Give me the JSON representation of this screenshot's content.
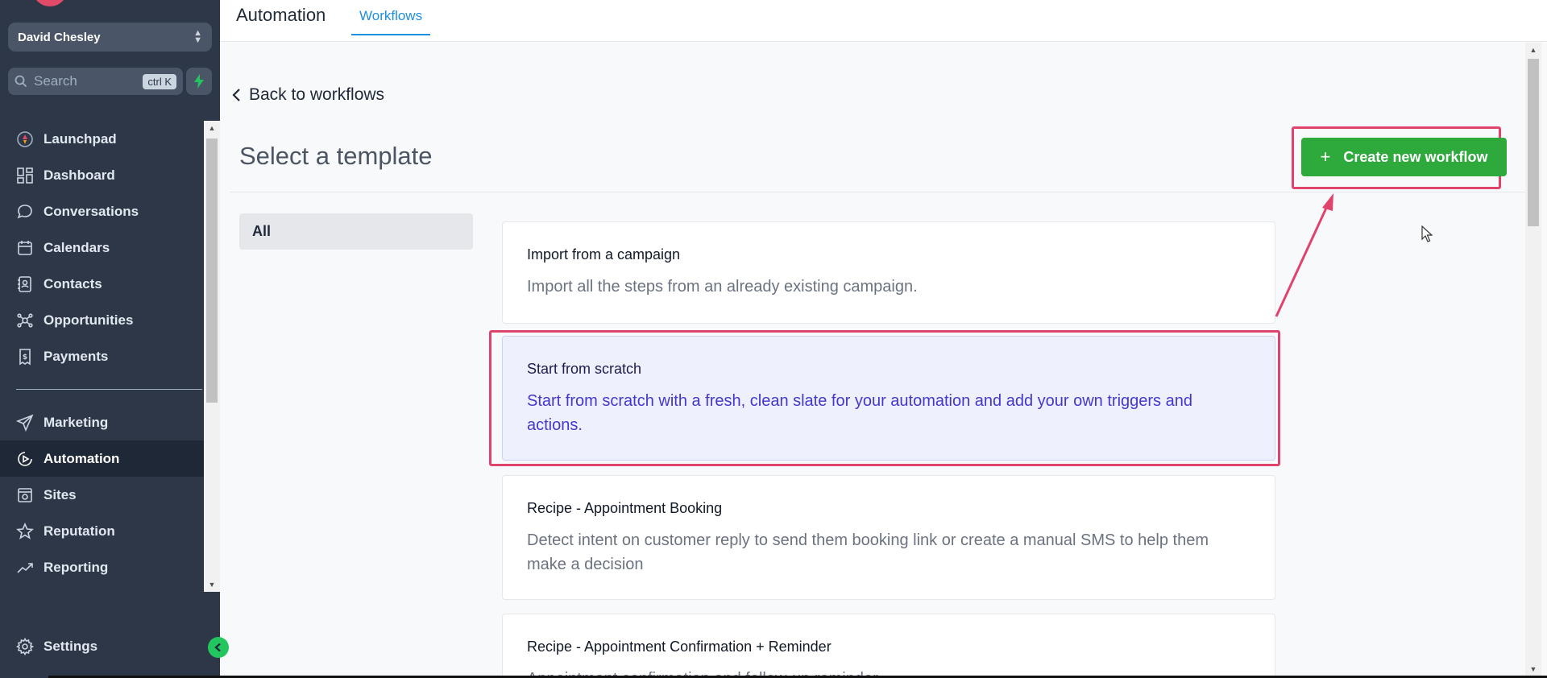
{
  "sidebar": {
    "account_name": "David Chesley",
    "search_placeholder": "Search",
    "search_shortcut": "ctrl K",
    "items": [
      {
        "label": "Launchpad"
      },
      {
        "label": "Dashboard"
      },
      {
        "label": "Conversations"
      },
      {
        "label": "Calendars"
      },
      {
        "label": "Contacts"
      },
      {
        "label": "Opportunities"
      },
      {
        "label": "Payments"
      },
      {
        "label": "Marketing"
      },
      {
        "label": "Automation"
      },
      {
        "label": "Sites"
      },
      {
        "label": "Reputation"
      },
      {
        "label": "Reporting"
      }
    ],
    "settings_label": "Settings",
    "active_item": "Automation"
  },
  "header": {
    "title": "Automation",
    "tab": "Workflows"
  },
  "main": {
    "back_label": "Back to workflows",
    "heading": "Select a template",
    "create_button": "Create new workflow",
    "category": "All",
    "templates": [
      {
        "title": "Import from a campaign",
        "description": "Import all the steps from an already existing campaign."
      },
      {
        "title": "Start from scratch",
        "description": "Start from scratch with a fresh, clean slate for your automation and add your own triggers and actions."
      },
      {
        "title": "Recipe - Appointment Booking",
        "description": "Detect intent on customer reply to send them booking link or create a manual SMS to help them make a decision"
      },
      {
        "title": "Recipe - Appointment Confirmation + Reminder",
        "description": "Appointment confirmation and follow-up reminder"
      }
    ]
  },
  "colors": {
    "sidebar_bg": "#2d3748",
    "primary_green": "#2eaa3c",
    "highlight": "#e0436b",
    "tab_blue": "#1d8fe1",
    "selected_text": "#4338ca"
  }
}
